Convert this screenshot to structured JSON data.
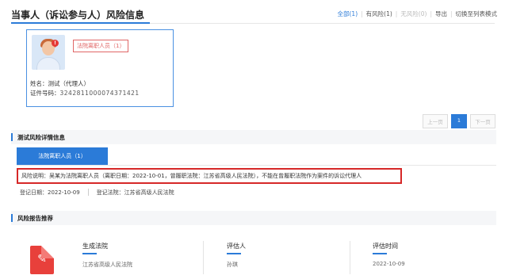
{
  "page": {
    "title": "当事人（诉讼参与人）风险信息"
  },
  "filters": {
    "all": "全部(1)",
    "has_risk": "有风险(1)",
    "no_risk": "无风险(0)",
    "export": "导出",
    "switch_view": "切换至列表模式"
  },
  "card": {
    "risk_tag": "法院离职人员（1）",
    "name": "姓名：测试（代理人）",
    "id_label": "证件号码：",
    "id_value": "3242811000074371421"
  },
  "pager": {
    "prev": "上一页",
    "current": "1",
    "next": "下一页"
  },
  "detail": {
    "section_title": "测试风险详情信息",
    "tab_label": "法院离职人员（1）",
    "description": "风险说明：吴某为法院离职人员（离职日期：2022-10-01，曾履职法院：江苏省高级人民法院），不能在曾履职法院作为案件的诉讼代理人",
    "register_date": "登记日期：2022-10-09",
    "register_court": "登记法院：江苏省高级人民法院"
  },
  "report": {
    "section_title": "风险报告推荐",
    "pdf_icon": "pdf-icon",
    "col1_heading": "生成法院",
    "col1_value": "江苏省高级人民法院",
    "col2_heading": "评估人",
    "col2_value": "孙琪",
    "col3_heading": "评估时间",
    "col3_value": "2022-10-09"
  },
  "colors": {
    "accent": "#2b7bd8",
    "alert": "#d62828"
  }
}
